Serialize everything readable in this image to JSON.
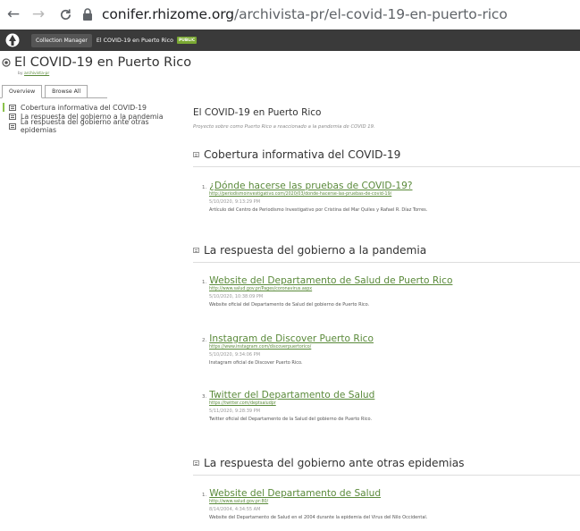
{
  "browser": {
    "url_host": "conifer.rhizome.org",
    "url_path": "/archivista-pr/el-covid-19-en-puerto-rico"
  },
  "header": {
    "collection_manager_label": "Collection Manager",
    "breadcrumb": "El COVID-19 en Puerto Rico",
    "badge": "PUBLIC"
  },
  "collection": {
    "title": "El COVID-19 en Puerto Rico",
    "by_prefix": "by",
    "by_user": "archivista-pr"
  },
  "tabs": [
    {
      "label": "Overview"
    },
    {
      "label": "Browse All"
    }
  ],
  "sidebar": {
    "items": [
      {
        "label": "Cobertura informativa del COVID-19"
      },
      {
        "label": "La respuesta del gobierno a la pandemia"
      },
      {
        "label": "La respuesta del gobierno ante otras epidemias"
      }
    ]
  },
  "main": {
    "title": "El COVID-19 en Puerto Rico",
    "description": "Proyecto sobre como Puerto Rico a reaccionado a la pandemia de COVID 19.",
    "sections": [
      {
        "title": "Cobertura informativa del COVID-19",
        "entries": [
          {
            "num": "1.",
            "title": "¿Dónde hacerse las pruebas de COVID-19?",
            "url": "http://periodismoinvestigativo.com/2020/03/donde-hacerse-las-pruebas-de-covid-19/",
            "date": "5/10/2020, 9:13:29 PM",
            "desc": "Artículo del Centro de Periodismo Investigativo por Cristina del Mar Quiles y Rafael R. Díaz Torres."
          }
        ]
      },
      {
        "title": "La respuesta del gobierno a la pandemia",
        "entries": [
          {
            "num": "1.",
            "title": "Website del Departamento de Salud de Puerto Rico",
            "url": "http://www.salud.gov.pr/Pages/coronavirus.aspx",
            "date": "5/10/2020, 10:38:09 PM",
            "desc": "Website oficial del Departamento de Salud del gobierno de Puerto Rico."
          },
          {
            "num": "2.",
            "title": "Instagram de Discover Puerto Rico",
            "url": "https://www.instagram.com/discoverpuertorico/",
            "date": "5/10/2020, 9:34:06 PM",
            "desc": "Instagram oficial de Discover Puerto Rico."
          },
          {
            "num": "3.",
            "title": "Twitter del Departamento de Salud",
            "url": "https://twitter.com/deptsaludpr",
            "date": "5/11/2020, 9:28:39 PM",
            "desc": "Twitter oficial del Departamento de la Salud del gobierno de Puerto Rico."
          }
        ]
      },
      {
        "title": "La respuesta del gobierno ante otras epidemias",
        "entries": [
          {
            "num": "1.",
            "title": "Website del Departamento de Salud",
            "url": "http://www.salud.gov.pr:80/",
            "date": "8/14/2004, 4:34:55 AM",
            "desc": "Website del Departamento de Salud en el 2004 durante la epidemia del Virus del Nilo Occidental."
          }
        ]
      }
    ]
  }
}
